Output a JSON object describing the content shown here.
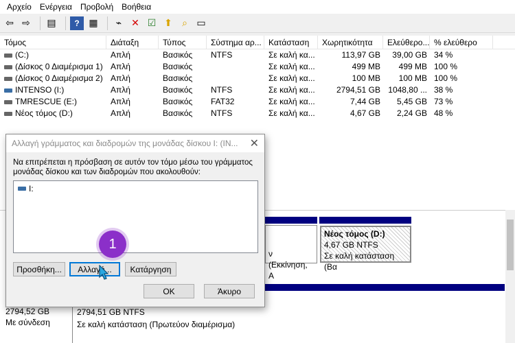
{
  "menu": [
    "Αρχείο",
    "Ενέργεια",
    "Προβολή",
    "Βοήθεια"
  ],
  "toolbar_icons": [
    "back-icon",
    "forward-icon",
    "console-tree-icon",
    "help-icon",
    "show-pane-icon",
    "connect-icon",
    "delete-icon",
    "checkmark-icon",
    "folder-up-icon",
    "search-icon",
    "properties-icon"
  ],
  "columns": [
    "Τόμος",
    "Διάταξη",
    "Τύπος",
    "Σύστημα αρ...",
    "Κατάσταση",
    "Χωρητικότητα",
    "Ελεύθερο...",
    "% ελεύθερο"
  ],
  "volumes": [
    {
      "name": "(C:)",
      "layout": "Απλή",
      "type": "Βασικός",
      "fs": "NTFS",
      "status": "Σε καλή κα...",
      "capacity": "113,97 GB",
      "free": "39,00 GB",
      "pct": "34 %",
      "usb": false
    },
    {
      "name": "(Δίσκος 0 Διαμέρισμα 1)",
      "layout": "Απλή",
      "type": "Βασικός",
      "fs": "",
      "status": "Σε καλή κα...",
      "capacity": "499 MB",
      "free": "499 MB",
      "pct": "100 %",
      "usb": false
    },
    {
      "name": "(Δίσκος 0 Διαμέρισμα 2)",
      "layout": "Απλή",
      "type": "Βασικός",
      "fs": "",
      "status": "Σε καλή κα...",
      "capacity": "100 MB",
      "free": "100 MB",
      "pct": "100 %",
      "usb": false
    },
    {
      "name": "INTENSO (I:)",
      "layout": "Απλή",
      "type": "Βασικός",
      "fs": "NTFS",
      "status": "Σε καλή κα...",
      "capacity": "2794,51 GB",
      "free": "1048,80 ...",
      "pct": "38 %",
      "usb": true
    },
    {
      "name": "TMRESCUE (E:)",
      "layout": "Απλή",
      "type": "Βασικός",
      "fs": "FAT32",
      "status": "Σε καλή κα...",
      "capacity": "7,44 GB",
      "free": "5,45 GB",
      "pct": "73 %",
      "usb": false
    },
    {
      "name": "Νέος τόμος (D:)",
      "layout": "Απλή",
      "type": "Βασικός",
      "fs": "NTFS",
      "status": "Σε καλή κα...",
      "capacity": "4,67 GB",
      "free": "2,24 GB",
      "pct": "48 %",
      "usb": false
    }
  ],
  "lower": {
    "boot_text": "ν (Εκκίνηση, Α",
    "d_title": "Νέος τόμος  (D:)",
    "d_size": "4,67 GB NTFS",
    "d_status": "Σε καλή κατάσταση (Βα",
    "disk_size": "2794,52 GB",
    "disk_state": "Με σύνδεση",
    "i_size": "2794,51 GB NTFS",
    "i_status": "Σε καλή κατάσταση (Πρωτεύον διαμέρισμα)"
  },
  "dialog": {
    "title": "Αλλαγή γράμματος και διαδρομών της μονάδας δίσκου I: (IN...",
    "description": "Να επιτρέπεται η πρόσβαση σε αυτόν τον τόμο μέσω του γράμματος μονάδας δίσκου και των διαδρομών που ακολουθούν:",
    "list_item": "I:",
    "add_label": "Προσθήκη...",
    "change_label": "Αλλαγή...",
    "remove_label": "Κατάργηση",
    "ok_label": "OK",
    "cancel_label": "Άκυρο"
  },
  "step_badge": "1",
  "colors": {
    "accent": "#0078d7",
    "badge": "#8b2fc9",
    "partition_bar": "#000080"
  }
}
